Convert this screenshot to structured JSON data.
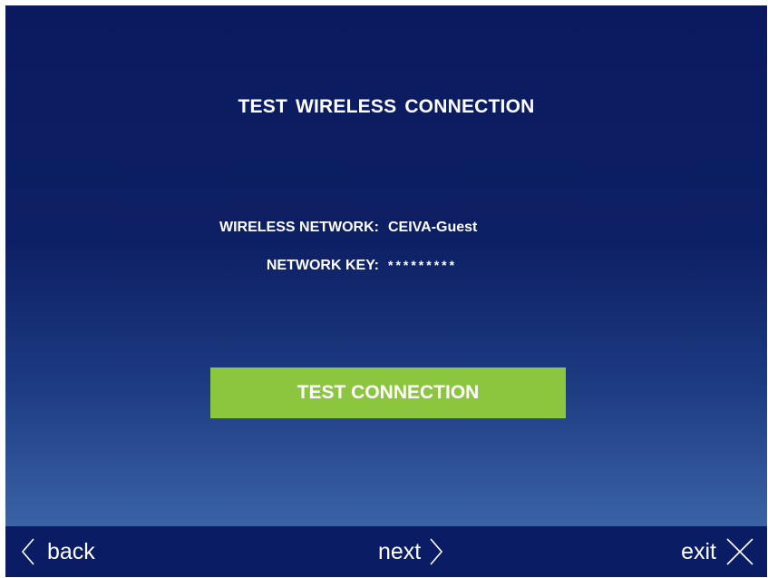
{
  "screen": {
    "title": "TEST  WIRELESS CONNECTION",
    "wireless_network_label": "WIRELESS NETWORK:",
    "wireless_network_value": "CEIVA-Guest",
    "network_key_label": "NETWORK KEY:",
    "network_key_value": "*********",
    "test_button_label": "TEST CONNECTION"
  },
  "nav": {
    "back_label": "back",
    "back_icon": "chevron-left-icon",
    "next_label": "next",
    "next_icon": "chevron-right-icon",
    "exit_label": "exit",
    "exit_icon": "close-icon"
  },
  "colors": {
    "background_top": "#0b1a5e",
    "background_bottom": "#3a63a4",
    "button_green": "#8cc63f",
    "navbar": "#0a1c63",
    "text": "#ffffff"
  }
}
